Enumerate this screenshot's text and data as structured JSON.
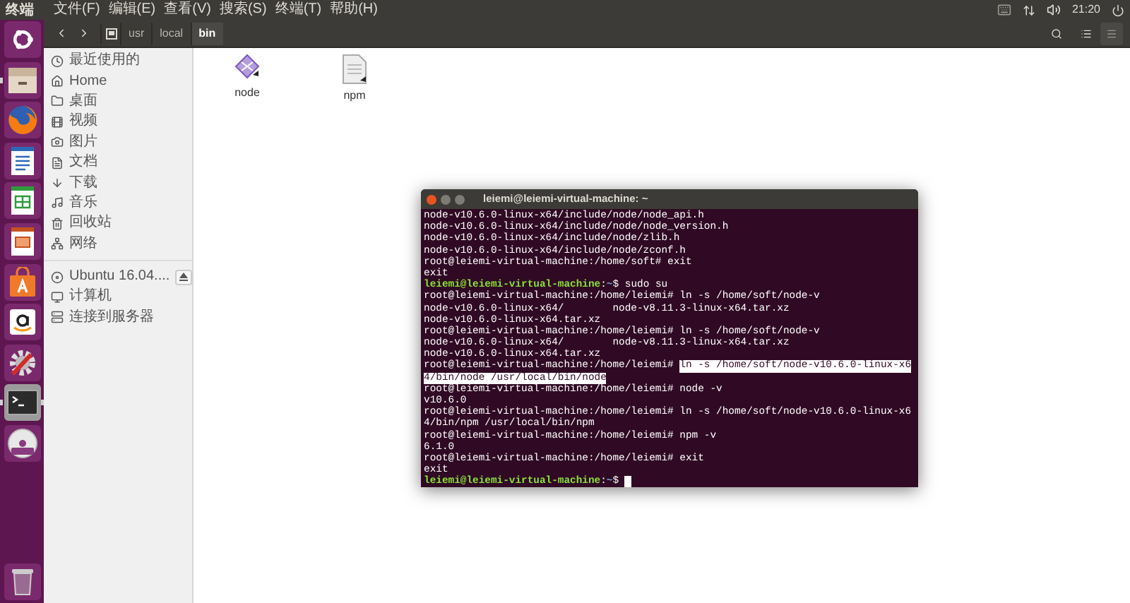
{
  "top_bar": {
    "app_name": "终端",
    "menus": [
      "文件(F)",
      "编辑(E)",
      "查看(V)",
      "搜索(S)",
      "终端(T)",
      "帮助(H)"
    ],
    "clock": "21:20"
  },
  "launcher": [
    {
      "kind": "dash",
      "running": false,
      "selected": false
    },
    {
      "kind": "files",
      "running": true,
      "selected": false
    },
    {
      "kind": "browser",
      "running": false,
      "selected": false
    },
    {
      "kind": "writer",
      "running": false,
      "selected": false
    },
    {
      "kind": "calc",
      "running": false,
      "selected": false
    },
    {
      "kind": "impress",
      "running": false,
      "selected": false
    },
    {
      "kind": "software",
      "running": false,
      "selected": false
    },
    {
      "kind": "shop",
      "running": false,
      "selected": false
    },
    {
      "kind": "settings",
      "running": false,
      "selected": false
    },
    {
      "kind": "terminal",
      "running": true,
      "selected": true
    },
    {
      "kind": "dvd",
      "running": false,
      "selected": false
    }
  ],
  "path_bar": [
    {
      "label": "usr",
      "selected": false
    },
    {
      "label": "local",
      "selected": false
    },
    {
      "label": "bin",
      "selected": true
    }
  ],
  "sidebar": {
    "places": [
      {
        "kind": "recent",
        "label": "最近使用的"
      },
      {
        "kind": "home",
        "label": "Home"
      },
      {
        "kind": "desktop",
        "label": "桌面"
      },
      {
        "kind": "video",
        "label": "视频"
      },
      {
        "kind": "pictures",
        "label": "图片"
      },
      {
        "kind": "documents",
        "label": "文档"
      },
      {
        "kind": "downloads",
        "label": "下载"
      },
      {
        "kind": "music",
        "label": "音乐"
      },
      {
        "kind": "trash",
        "label": "回收站"
      },
      {
        "kind": "network",
        "label": "网络"
      }
    ],
    "devices": [
      {
        "kind": "disc",
        "label": "Ubuntu 16.04....",
        "eject": true
      },
      {
        "kind": "computer",
        "label": "计算机",
        "eject": false
      },
      {
        "kind": "server",
        "label": "连接到服务器",
        "eject": false
      }
    ]
  },
  "files": [
    {
      "kind": "executable",
      "name": "node"
    },
    {
      "kind": "script",
      "name": "npm"
    }
  ],
  "terminal": {
    "title": "leiemi@leiemi-virtual-machine: ~",
    "lines": [
      [
        {
          "kind": "plain",
          "text": "node-v10.6.0-linux-x64/include/node/node_api.h"
        }
      ],
      [
        {
          "kind": "plain",
          "text": "node-v10.6.0-linux-x64/include/node/node_version.h"
        }
      ],
      [
        {
          "kind": "plain",
          "text": "node-v10.6.0-linux-x64/include/node/zlib.h"
        }
      ],
      [
        {
          "kind": "plain",
          "text": "node-v10.6.0-linux-x64/include/node/zconf.h"
        }
      ],
      [
        {
          "kind": "plain",
          "text": "root@leiemi-virtual-machine:/home/soft# exit"
        }
      ],
      [
        {
          "kind": "plain",
          "text": "exit"
        }
      ],
      [
        {
          "kind": "user",
          "text": "leiemi@leiemi-virtual-machine"
        },
        {
          "kind": "plain",
          "text": ":"
        },
        {
          "kind": "path",
          "text": "~"
        },
        {
          "kind": "plain",
          "text": "$ sudo su"
        }
      ],
      [
        {
          "kind": "plain",
          "text": "root@leiemi-virtual-machine:/home/leiemi# ln -s /home/soft/node-v"
        }
      ],
      [
        {
          "kind": "plain",
          "text": "node-v10.6.0-linux-x64/        node-v8.11.3-linux-x64.tar.xz"
        }
      ],
      [
        {
          "kind": "plain",
          "text": "node-v10.6.0-linux-x64.tar.xz"
        }
      ],
      [
        {
          "kind": "plain",
          "text": "root@leiemi-virtual-machine:/home/leiemi# ln -s /home/soft/node-v"
        }
      ],
      [
        {
          "kind": "plain",
          "text": "node-v10.6.0-linux-x64/        node-v8.11.3-linux-x64.tar.xz"
        }
      ],
      [
        {
          "kind": "plain",
          "text": "node-v10.6.0-linux-x64.tar.xz"
        }
      ],
      [
        {
          "kind": "plain",
          "text": "root@leiemi-virtual-machine:/home/leiemi# "
        },
        {
          "kind": "selected",
          "text": "ln -s /home/soft/node-v10.6.0-linux-x6"
        }
      ],
      [
        {
          "kind": "selected",
          "text": "4/bin/node /usr/local/bin/node"
        }
      ],
      [
        {
          "kind": "plain",
          "text": "root@leiemi-virtual-machine:/home/leiemi# node -v"
        }
      ],
      [
        {
          "kind": "plain",
          "text": "v10.6.0"
        }
      ],
      [
        {
          "kind": "plain",
          "text": "root@leiemi-virtual-machine:/home/leiemi# ln -s /home/soft/node-v10.6.0-linux-x6"
        }
      ],
      [
        {
          "kind": "plain",
          "text": "4/bin/npm /usr/local/bin/npm"
        }
      ],
      [
        {
          "kind": "plain",
          "text": "root@leiemi-virtual-machine:/home/leiemi# npm -v"
        }
      ],
      [
        {
          "kind": "plain",
          "text": "6.1.0"
        }
      ],
      [
        {
          "kind": "plain",
          "text": "root@leiemi-virtual-machine:/home/leiemi# exit"
        }
      ],
      [
        {
          "kind": "plain",
          "text": "exit"
        }
      ],
      [
        {
          "kind": "user",
          "text": "leiemi@leiemi-virtual-machine"
        },
        {
          "kind": "plain",
          "text": ":"
        },
        {
          "kind": "path",
          "text": "~"
        },
        {
          "kind": "plain",
          "text": "$ "
        }
      ]
    ]
  }
}
